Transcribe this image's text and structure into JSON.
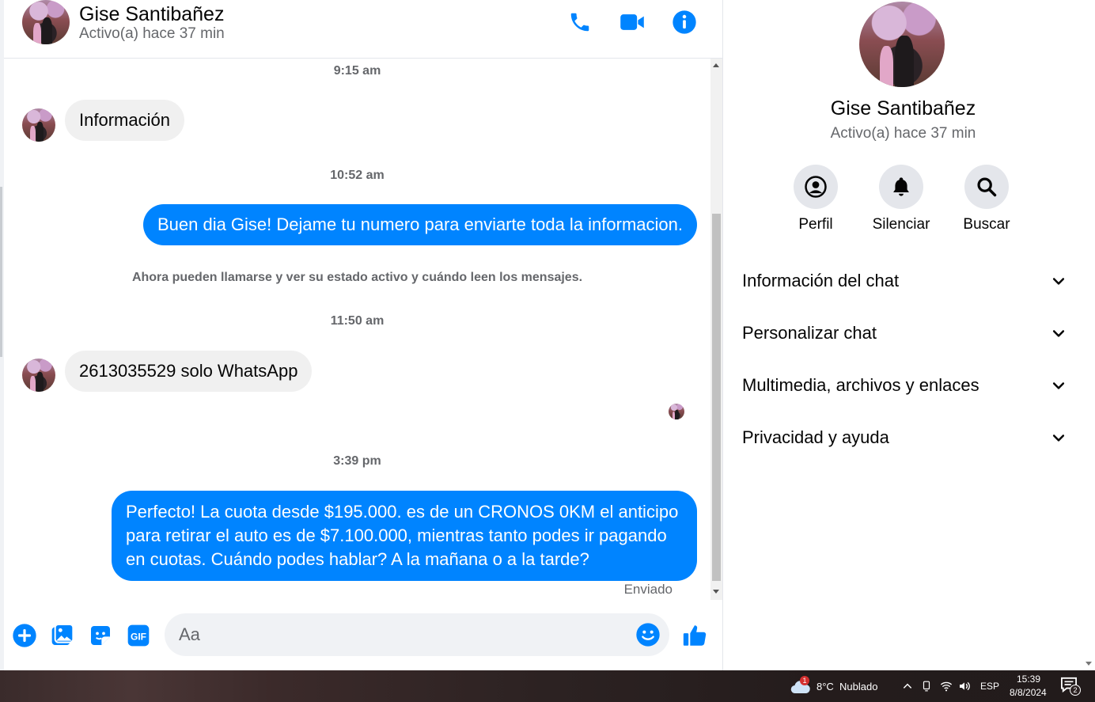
{
  "contact": {
    "name": "Gise Santibañez",
    "status": "Activo(a) hace 37 min"
  },
  "messages": {
    "ts1": "9:15 am",
    "in1": "Información",
    "ts2": "10:52 am",
    "out1": "Buen dia Gise! Dejame tu numero para enviarte toda la informacion.",
    "system": "Ahora pueden llamarse y ver su estado activo y cuándo leen los mensajes.",
    "ts3": "11:50 am",
    "in2": "2613035529 solo WhatsApp",
    "ts4": "3:39 pm",
    "out2": "Perfecto! La cuota desde $195.000. es de un CRONOS 0KM el anticipo para retirar el auto es de $7.100.000, mientras tanto podes ir pagando en cuotas. Cuándo podes hablar? A la mañana o a la tarde?",
    "sent_label": "Enviado"
  },
  "composer": {
    "placeholder": "Aa"
  },
  "panel": {
    "actions": {
      "profile": "Perfil",
      "mute": "Silenciar",
      "search": "Buscar"
    },
    "sections": {
      "chat_info": "Información del chat",
      "customize": "Personalizar chat",
      "media": "Multimedia, archivos y enlaces",
      "privacy": "Privacidad y ayuda"
    }
  },
  "taskbar": {
    "weather": "8°C  Nublado",
    "weather_badge": "1",
    "lang": "ESP",
    "time": "15:39",
    "date": "8/8/2024",
    "notif_count": "2"
  },
  "colors": {
    "accent": "#0084ff",
    "bubble_in": "#f0f0f0",
    "icon_bg": "#e4e6eb"
  }
}
